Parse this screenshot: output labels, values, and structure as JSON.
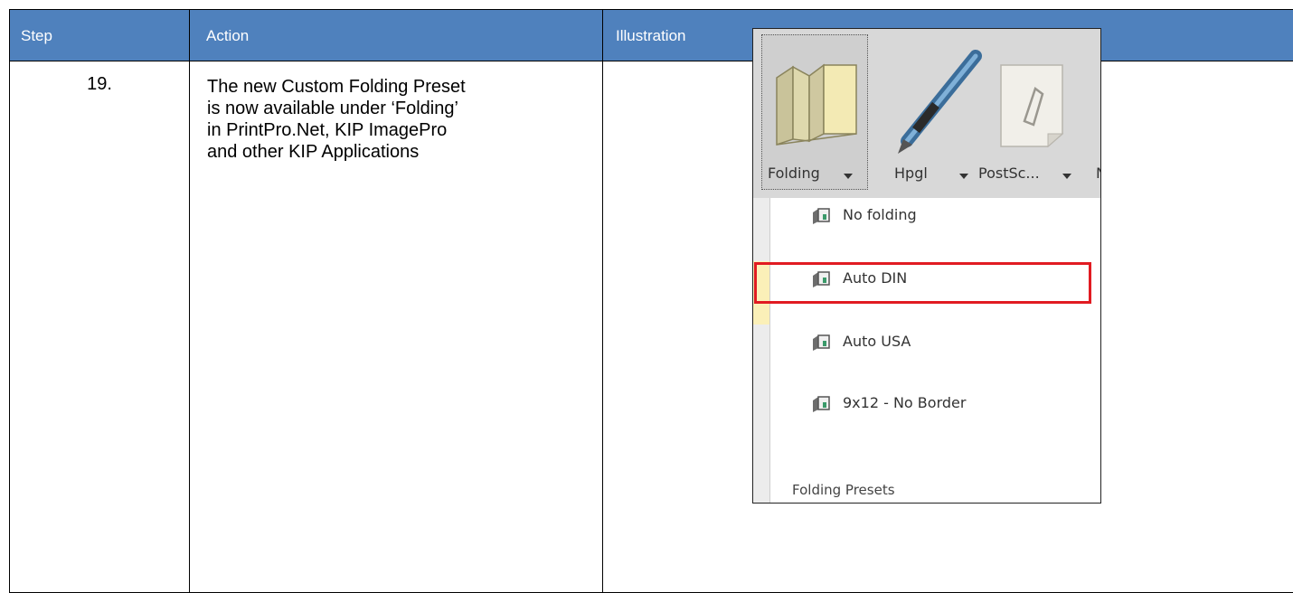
{
  "table": {
    "headers": {
      "step": "Step",
      "action": "Action",
      "illustration": "Illustration"
    },
    "row": {
      "step": "19.",
      "action_lines": [
        "The new Custom Folding Preset",
        "is now available under ‘Folding’",
        "in PrintPro.Net, KIP ImagePro",
        "and other KIP Applications"
      ]
    }
  },
  "illustration": {
    "ribbon": {
      "folding_label": "Folding",
      "hpgl_label": "Hpgl",
      "postscript_label": "PostSc...",
      "cut_off_letter": "N"
    },
    "menu": {
      "items": [
        {
          "label": "No folding",
          "icon": "folding-preset-icon"
        },
        {
          "label": "Auto DIN",
          "icon": "folding-preset-icon"
        },
        {
          "label": "Auto USA",
          "icon": "folding-preset-icon"
        },
        {
          "label": "9x12 - No Border",
          "icon": "folding-preset-icon",
          "highlighted": true
        }
      ],
      "footer": "Folding Presets"
    },
    "colors": {
      "header_bg": "#4f81bd",
      "highlight": "#e11b22",
      "ribbon_bg": "#d8d8d8"
    }
  }
}
